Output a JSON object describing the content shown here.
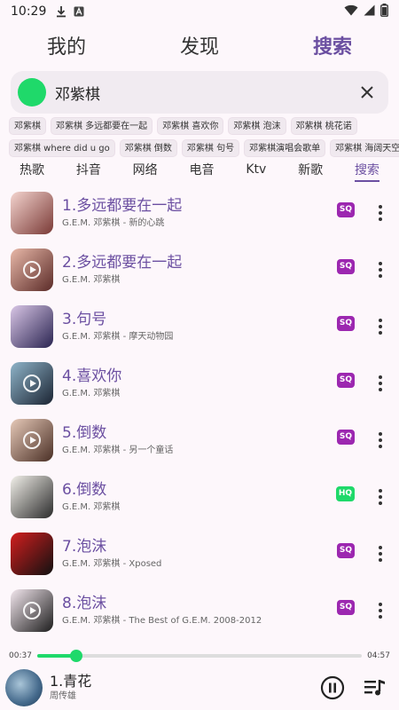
{
  "status_bar": {
    "time": "10:29"
  },
  "top_tabs": [
    {
      "label": "我的"
    },
    {
      "label": "发现"
    },
    {
      "label": "搜索"
    }
  ],
  "search": {
    "query": "邓紫棋"
  },
  "chips_row1": [
    "邓紫棋",
    "邓紫棋 多远都要在一起",
    "邓紫棋 喜欢你",
    "邓紫棋 泡沫",
    "邓紫棋 桃花诺"
  ],
  "chips_row2": [
    "邓紫棋 where did u go",
    "邓紫棋 倒数",
    "邓紫棋 句号",
    "邓紫棋演唱会歌单",
    "邓紫棋 海阔天空"
  ],
  "category_tabs": [
    "热歌",
    "抖音",
    "网络",
    "电音",
    "Ktv",
    "新歌",
    "搜索"
  ],
  "colors": {
    "accent": "#6b4fa1",
    "green": "#1fd96a",
    "sq_badge": "#9c27b0",
    "hq_badge": "#1fd96a"
  },
  "songs": [
    {
      "title": "1.多远都要在一起",
      "subtitle": "G.E.M. 邓紫棋 - 新的心跳",
      "badge": "SQ",
      "cover_colors": [
        "#f4d4cf",
        "#7a3a36"
      ],
      "has_play": false
    },
    {
      "title": "2.多远都要在一起",
      "subtitle": "G.E.M. 邓紫棋",
      "badge": "SQ",
      "cover_colors": [
        "#e8b8a8",
        "#5b2b28"
      ],
      "has_play": true
    },
    {
      "title": "3.句号",
      "subtitle": "G.E.M. 邓紫棋 - 摩天动物园",
      "badge": "SQ",
      "cover_colors": [
        "#d9c6e6",
        "#2a2451"
      ],
      "has_play": false
    },
    {
      "title": "4.喜欢你",
      "subtitle": "G.E.M. 邓紫棋",
      "badge": "SQ",
      "cover_colors": [
        "#8fb4c9",
        "#1b2433"
      ],
      "has_play": true
    },
    {
      "title": "5.倒数",
      "subtitle": "G.E.M. 邓紫棋 - 另一个童话",
      "badge": "SQ",
      "cover_colors": [
        "#e6c9b8",
        "#4a2f25"
      ],
      "has_play": true
    },
    {
      "title": "6.倒数",
      "subtitle": "G.E.M. 邓紫棋",
      "badge": "HQ",
      "cover_colors": [
        "#f2f0ea",
        "#2b2b2b"
      ],
      "has_play": false
    },
    {
      "title": "7.泡沫",
      "subtitle": "G.E.M. 邓紫棋 - Xposed",
      "badge": "SQ",
      "cover_colors": [
        "#d21e1e",
        "#111111"
      ],
      "has_play": false
    },
    {
      "title": "8.泡沫",
      "subtitle": "G.E.M. 邓紫棋 - The Best of G.E.M. 2008-2012",
      "badge": "SQ",
      "cover_colors": [
        "#f3e7ee",
        "#1d1d1d"
      ],
      "has_play": true
    },
    {
      "title": "",
      "subtitle": "",
      "badge": "",
      "cover_colors": [
        "#e9a24e",
        "#4b3a2a"
      ],
      "has_play": false
    }
  ],
  "player": {
    "elapsed": "00:37",
    "duration": "04:57",
    "progress": 0.12,
    "title": "1.青花",
    "artist": "周传雄"
  }
}
